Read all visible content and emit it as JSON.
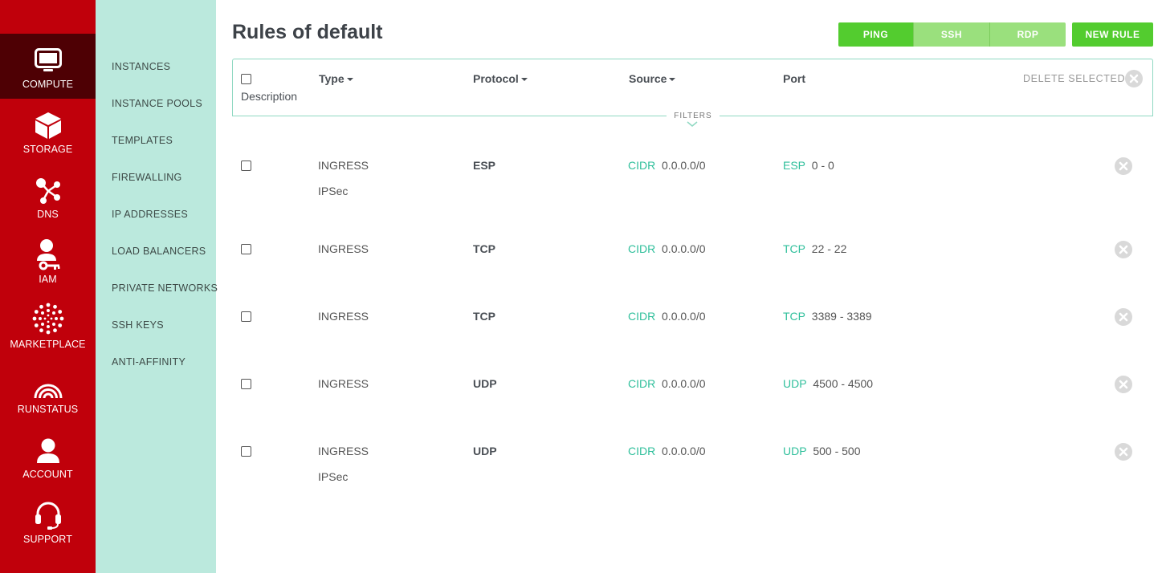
{
  "nav": {
    "items": [
      {
        "label": "COMPUTE",
        "icon": "monitor-icon"
      },
      {
        "label": "STORAGE",
        "icon": "cube-icon"
      },
      {
        "label": "DNS",
        "icon": "network-nodes-icon"
      },
      {
        "label": "IAM",
        "icon": "user-key-icon"
      },
      {
        "label": "MARKETPLACE",
        "icon": "dots-circle-icon"
      },
      {
        "label": "RUNSTATUS",
        "icon": "signal-icon"
      },
      {
        "label": "ACCOUNT",
        "icon": "user-icon"
      },
      {
        "label": "SUPPORT",
        "icon": "headset-icon"
      }
    ],
    "active": "COMPUTE"
  },
  "submenu": {
    "items": [
      "INSTANCES",
      "INSTANCE POOLS",
      "TEMPLATES",
      "FIREWALLING",
      "IP ADDRESSES",
      "LOAD BALANCERS",
      "PRIVATE NETWORKS",
      "SSH KEYS",
      "ANTI-AFFINITY"
    ]
  },
  "page": {
    "title": "Rules of default"
  },
  "toolbar": {
    "ping": "PING",
    "ssh": "SSH",
    "rdp": "RDP",
    "new_rule": "NEW RULE"
  },
  "table": {
    "headers": {
      "type": "Type",
      "protocol": "Protocol",
      "source": "Source",
      "port": "Port",
      "description": "Description"
    },
    "delete_selected": "DELETE SELECTED",
    "filters": "FILTERS",
    "rows": [
      {
        "type": "INGRESS",
        "description": "IPSec",
        "protocol": "ESP",
        "source_kind": "CIDR",
        "source_value": "0.0.0.0/0",
        "port_proto": "ESP",
        "port_range": "0 - 0"
      },
      {
        "type": "INGRESS",
        "description": "",
        "protocol": "TCP",
        "source_kind": "CIDR",
        "source_value": "0.0.0.0/0",
        "port_proto": "TCP",
        "port_range": "22 - 22"
      },
      {
        "type": "INGRESS",
        "description": "",
        "protocol": "TCP",
        "source_kind": "CIDR",
        "source_value": "0.0.0.0/0",
        "port_proto": "TCP",
        "port_range": "3389 - 3389"
      },
      {
        "type": "INGRESS",
        "description": "",
        "protocol": "UDP",
        "source_kind": "CIDR",
        "source_value": "0.0.0.0/0",
        "port_proto": "UDP",
        "port_range": "4500 - 4500"
      },
      {
        "type": "INGRESS",
        "description": "IPSec",
        "protocol": "UDP",
        "source_kind": "CIDR",
        "source_value": "0.0.0.0/0",
        "port_proto": "UDP",
        "port_range": "500 - 500"
      }
    ]
  },
  "colors": {
    "nav_bg": "#c0000b",
    "nav_active": "#4e0004",
    "submenu_bg": "#bbe9dd",
    "accent_green": "#53cc2f",
    "accent_teal": "#2fbf9b"
  }
}
